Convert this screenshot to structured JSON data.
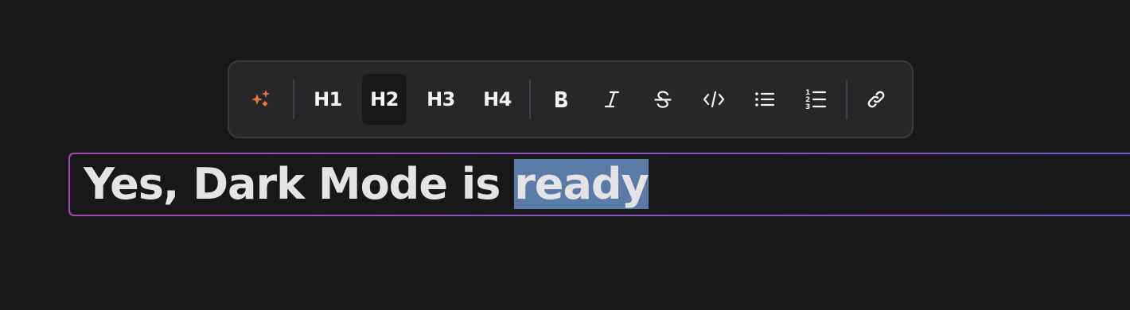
{
  "toolbar": {
    "ai_icon": "sparkles-icon",
    "ai_color": "#e8773b",
    "headings": [
      "H1",
      "H2",
      "H3",
      "H4"
    ],
    "active_heading": "H2",
    "format_icons": [
      "bold-icon",
      "italic-icon",
      "strikethrough-icon",
      "code-icon",
      "bullet-list-icon",
      "numbered-list-icon"
    ],
    "link_icon": "link-icon"
  },
  "editor": {
    "text_before": "Yes, Dark Mode is ",
    "selected_text": "ready",
    "selection_color": "#5a7ba6",
    "border_gradient": [
      "#a04bb0",
      "#7356d0"
    ]
  }
}
